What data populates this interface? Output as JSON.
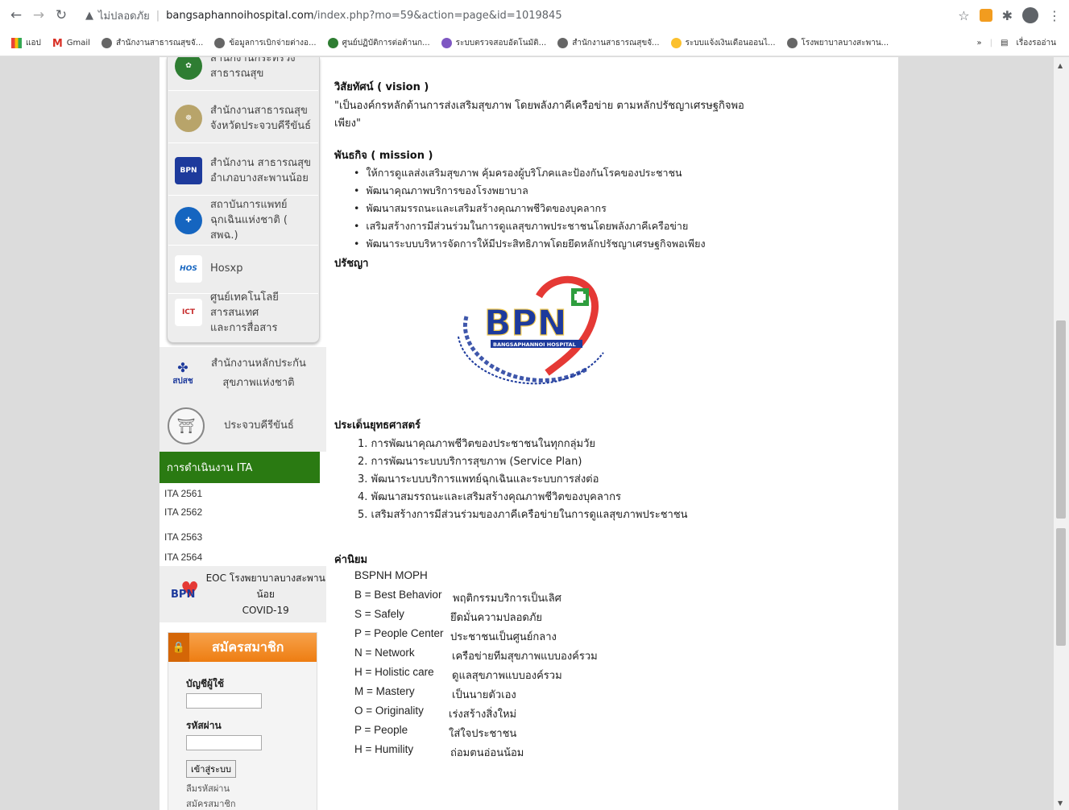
{
  "browser": {
    "security_label": "ไม่ปลอดภัย",
    "url_host": "bangsaphannoihospital.com",
    "url_path": "/index.php?mo=59&action=page&id=1019845",
    "bookmarks": [
      "แอป",
      "Gmail",
      "สำนักงานสาธารณสุขจั...",
      "ข้อมูลการเบิกจ่ายต่างอ...",
      "ศูนย์ปฏิบัติการต่อต้านก...",
      "ระบบตรวจสอบอัตโนมัติ...",
      "สำนักงานสาธารณสุขจั...",
      "ระบบแจ้งเงินเดือนออนไ...",
      "โรงพยาบาลบางสะพาน..."
    ],
    "reading_list": "เรื่องรออ่าน"
  },
  "sidebar": {
    "links": [
      {
        "label": "สำนักงานกระทรวง\nสาธารณสุข",
        "icon": "moph-seal-icon"
      },
      {
        "label": "สำนักงานสาธารณสุข\nจังหวัดประจวบคีรีขันธ์",
        "icon": "provincial-seal-icon"
      },
      {
        "label": "สำนักงาน สาธารณสุข\nอำเภอบางสะพานน้อย",
        "icon": "bpn-logo-icon"
      },
      {
        "label": "สถาบันการแพทย์\nฉุกเฉินแห่งชาติ ( สพฉ.)",
        "icon": "emergency-logo-icon"
      },
      {
        "label": "Hosxp",
        "icon": "hosxp-logo-icon"
      },
      {
        "label": "ศูนย์เทคโนโลยีสารสนเทศ\nและการสื่อสาร",
        "icon": "ict-logo-icon"
      }
    ],
    "nhso_label_1": "สำนักงานหลักประกัน",
    "nhso_label_2": "สุขภาพแห่งชาติ",
    "nhso_logo_text": "สปสช",
    "prachuap_label": "ประจวบคีรีขันธ์",
    "ita_header": "การดำเนินงาน ITA",
    "ita_links": [
      "ITA 2561",
      "ITA 2562",
      "ITA 2563",
      "ITA 2564"
    ],
    "eoc_label_1": "EOC โรงพยาบาลบางสะพานน้อย",
    "eoc_label_2": "COVID-19",
    "member": {
      "title": "สมัครสมาชิก",
      "username_label": "บัญชีผู้ใช้",
      "password_label": "รหัสผ่าน",
      "login_button": "เข้าสู่ระบบ",
      "forgot_link": "ลืมรหัสผ่าน",
      "register_link": "สมัครสมาชิก"
    }
  },
  "content": {
    "vision_heading": "วิสัยทัศน์ ( vision )",
    "vision_line1": "\"เป็นองค์กรหลักด้านการส่งเสริมสุขภาพ โดยพลังภาคีเครือข่าย ตามหลักปรัชญาเศรษฐกิจพอ",
    "vision_line2": "เพียง\"",
    "mission_heading": "พันธกิจ ( mission )",
    "missions": [
      "ให้การดูแลส่งเสริมสุขภาพ คุ้มครองผู้บริโภคและป้องกันโรคของประชาชน",
      "พัฒนาคุณภาพบริการของโรงพยาบาล",
      "พัฒนาสมรรถนะและเสริมสร้างคุณภาพชีวิตของบุคลากร",
      "เสริมสร้างการมีส่วนร่วมในการดูแลสุขภาพประชาชนโดยพลังภาคีเครือข่าย",
      "พัฒนาระบบบริหารจัดการให้มีประสิทธิภาพโดยยึดหลักปรัชญาเศรษฐกิจพอเพียง"
    ],
    "philosophy_heading": "ปรัชญา",
    "logo_text": "BPN",
    "logo_sub": "BANGSAPHANNOI HOSPITAL",
    "strategy_heading": "ประเด็นยุทธศาสตร์",
    "strategies": [
      "1.  การพัฒนาคุณภาพชีวิตของประชาชนในทุกกลุ่มวัย",
      "2. การพัฒนาระบบบริการสุขภาพ (Service Plan)",
      "3. พัฒนาระบบบริการแพทย์ฉุกเฉินและระบบการส่งต่อ",
      "4.  พัฒนาสมรรถนะและเสริมสร้างคุณภาพชีวิตของบุคลากร",
      "5. เสริมสร้างการมีส่วนร่วมของภาคีเครือข่ายในการดูแลสุขภาพประชาชน"
    ],
    "values_heading": "ค่านิยม",
    "values_title": "BSPNH MOPH",
    "values": [
      {
        "key": "B = Best Behavior",
        "desc": "พฤติกรรมบริการเป็นเลิศ"
      },
      {
        "key": "S = Safely",
        "desc": "ยึดมั่นความปลอดภัย"
      },
      {
        "key": "P = People Center",
        "desc": "ประชาชนเป็นศูนย์กลาง"
      },
      {
        "key": "N = Network",
        "desc": "เครือข่ายทีมสุขภาพแบบองค์รวม"
      },
      {
        "key": "H = Holistic care",
        "desc": "ดูแลสุขภาพแบบองค์รวม"
      },
      {
        "key": "M = Mastery",
        "desc": "เป็นนายตัวเอง"
      },
      {
        "key": "O = Originality",
        "desc": "เร่งสร้างสิ่งใหม่"
      },
      {
        "key": "P = People",
        "desc": "ใส่ใจประชาชน"
      },
      {
        "key": "H = Humility",
        "desc": "ถ่อมตนอ่อนน้อม"
      }
    ]
  },
  "colors": {
    "ita_green": "#2a7a12",
    "member_orange": "#ee7d12",
    "logo_blue": "#1d3a9c",
    "logo_red": "#e53935"
  }
}
